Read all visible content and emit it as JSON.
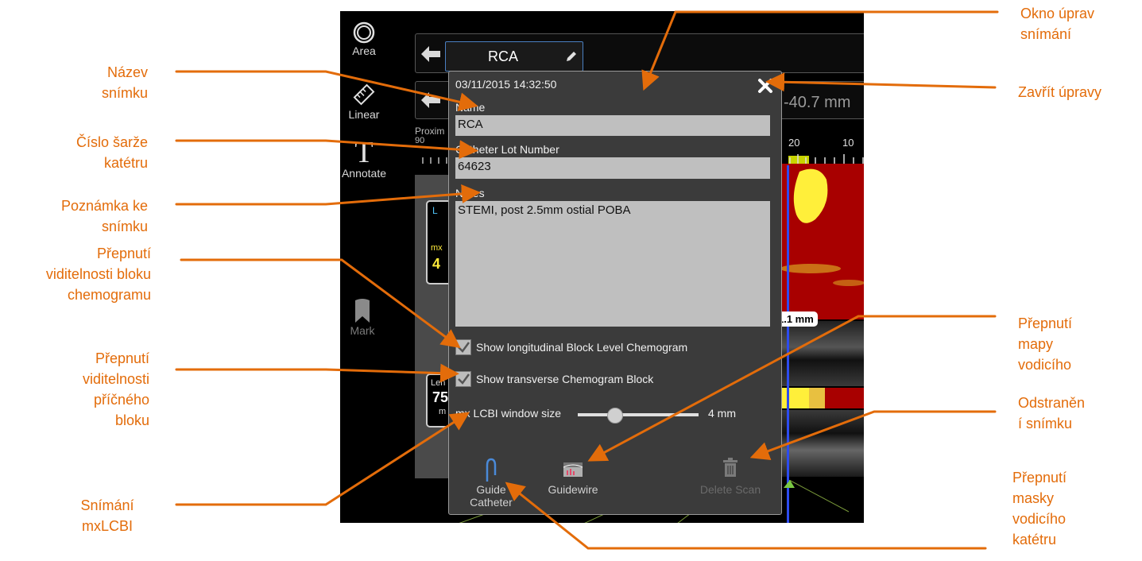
{
  "callouts": {
    "okno_uprav": [
      "Okno úprav",
      "snímání"
    ],
    "nazev": [
      "Název",
      "snímku"
    ],
    "zavrit": [
      "Zavřít úpravy"
    ],
    "cislo_sarze": [
      "Číslo šarže",
      "katétru"
    ],
    "poznamka": [
      "Poznámka ke",
      "snímku"
    ],
    "chemogram_block": [
      "Přepnutí",
      "viditelnosti bloku",
      "chemogramu"
    ],
    "transverse_block": [
      "Přepnutí",
      "viditelnosti",
      "příčného",
      "bloku"
    ],
    "guidewire_map": [
      "Přepnutí",
      "mapy",
      "vodicího"
    ],
    "delete_scan": [
      "Odstraněn",
      "í snímku"
    ],
    "mxlcbi": [
      "Snímání",
      "mxLCBI"
    ],
    "guide_mask": [
      "Přepnutí",
      "masky",
      "vodicího",
      "katétru"
    ]
  },
  "app": {
    "tools": {
      "area": "Area",
      "linear": "Linear",
      "annotate": "Annotate",
      "mark": "Mark"
    },
    "scan_name_tab": "RCA",
    "measurement": "-40.7 mm",
    "proximal_label": "Proxim",
    "ruler_left": "90",
    "ruler_ticks": [
      "20",
      "10"
    ],
    "marker_label": "1.1 mm",
    "side_left_partial": [
      "L",
      "mx",
      "4",
      "Len",
      "75",
      "m"
    ],
    "colors": {
      "chemogram_red": "#A80000",
      "chemogram_yellow": "#FFEF3A",
      "accent_blue": "#2D4CF0"
    }
  },
  "dialog": {
    "timestamp": "03/11/2015 14:32:50",
    "name_label": "Name",
    "name_value": "RCA",
    "lot_label": "Catheter Lot Number",
    "lot_value": "64623",
    "notes_label": "Notes",
    "notes_value": "STEMI, post 2.5mm ostial POBA",
    "check_longitudinal": "Show longitudinal Block Level Chemogram",
    "check_transverse": "Show transverse Chemogram Block",
    "window_size_label": "mx LCBI window size",
    "window_size_value": "4 mm",
    "window_size_fraction": 0.3,
    "guide_catheter_label": [
      "Guide",
      "Catheter"
    ],
    "guidewire_label": "Guidewire",
    "delete_label": "Delete Scan"
  }
}
